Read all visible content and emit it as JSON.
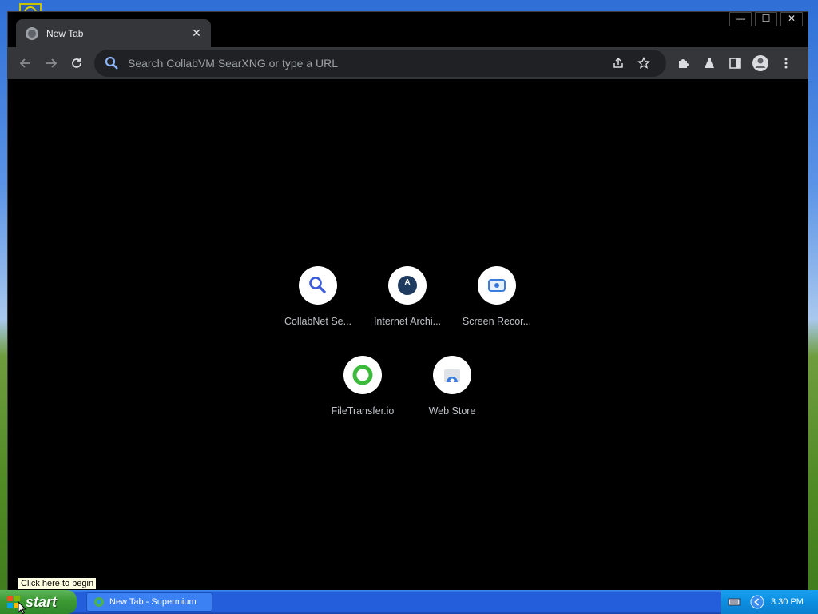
{
  "window": {
    "tab_title": "New Tab",
    "tab_close": "✕",
    "controls": {
      "minimize": "—",
      "maximize": "☐",
      "close": "✕"
    }
  },
  "toolbar": {
    "omnibox_placeholder": "Search CollabVM SearXNG or type a URL"
  },
  "shortcuts": [
    {
      "label": "CollabNet Se...",
      "icon": "search-icon"
    },
    {
      "label": "Internet Archi...",
      "icon": "archive-icon"
    },
    {
      "label": "Screen Recor...",
      "icon": "record-icon"
    },
    {
      "label": "FileTransfer.io",
      "icon": "filetransfer-icon"
    },
    {
      "label": "Web Store",
      "icon": "webstore-icon"
    }
  ],
  "taskbar": {
    "start_label": "start",
    "task_label": "New Tab - Supermium",
    "time": "3:30 PM",
    "tooltip": "Click here to begin"
  },
  "colors": {
    "browser_bg": "#000000",
    "toolbar_bg": "#35363a",
    "taskbar_blue": "#245edb",
    "start_green": "#3c9a34"
  }
}
